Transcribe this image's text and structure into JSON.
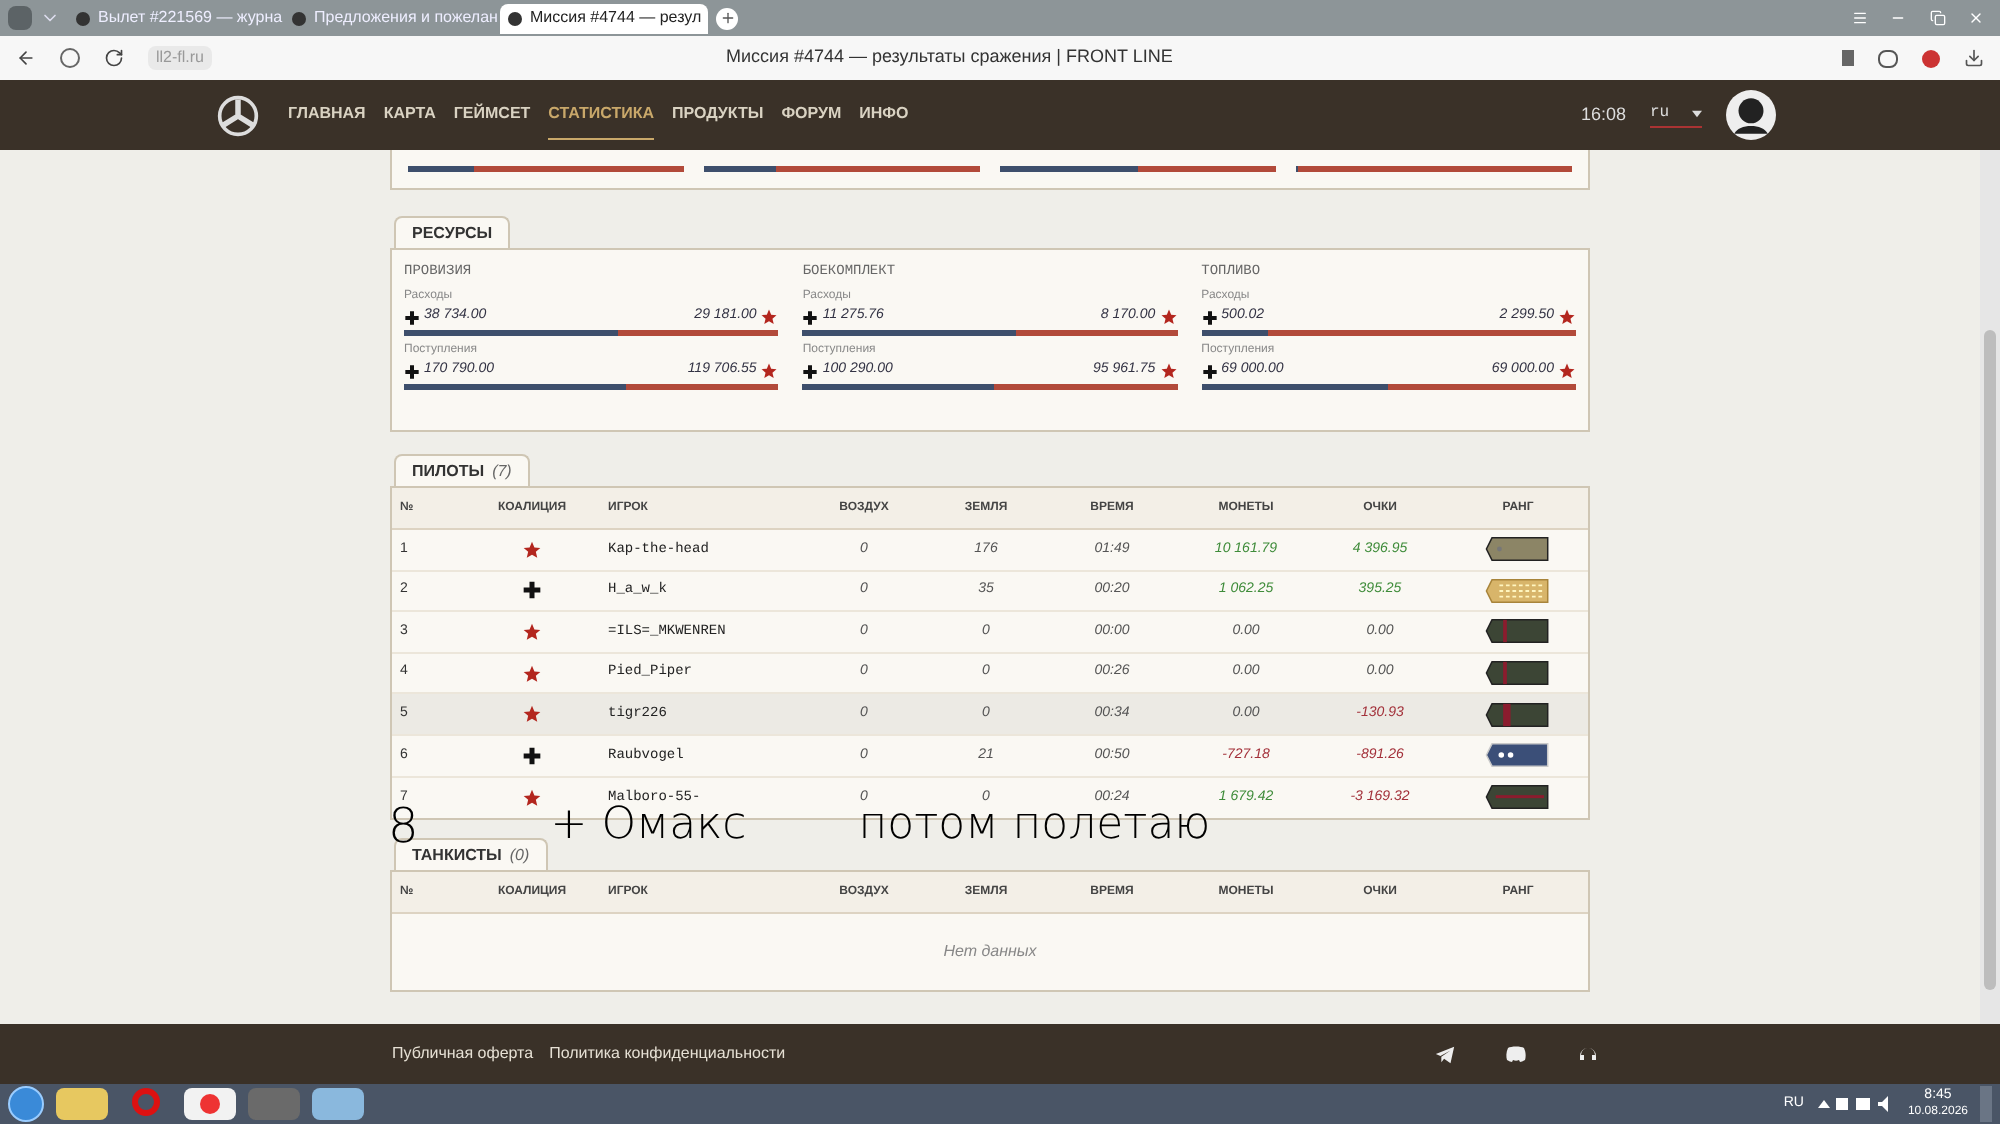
{
  "browser": {
    "tabs": [
      {
        "title": "Вылет #221569 — журна",
        "selected": false
      },
      {
        "title": "Предложения и пожелан",
        "selected": false
      },
      {
        "title": "Миссия #4744 — резул",
        "selected": true
      }
    ],
    "address": "ll2-fl.ru",
    "page_title": "Миссия #4744 — результаты сражения | FRONT LINE"
  },
  "site_nav": {
    "items": [
      {
        "label": "ГЛАВНАЯ",
        "selected": false
      },
      {
        "label": "КАРТА",
        "selected": false
      },
      {
        "label": "ГЕЙМСЕТ",
        "selected": false
      },
      {
        "label": "СТАТИСТИКА",
        "selected": true
      },
      {
        "label": "ПРОДУКТЫ",
        "selected": false
      },
      {
        "label": "ФОРУМ",
        "selected": false
      },
      {
        "label": "ИНФО",
        "selected": false
      }
    ],
    "time": "16:08",
    "language": "ru"
  },
  "top_bars": [
    {
      "level": 0.24
    },
    {
      "level": 0.26
    },
    {
      "level": 0.5
    },
    {
      "level": 0.01
    }
  ],
  "resources": {
    "title": "РЕСУРСЫ",
    "groups": [
      {
        "name": "ПРОВИЗИЯ",
        "rows": [
          {
            "label": "Расходы",
            "axis": "38 734.00",
            "allies": "29 181.00",
            "level": 0.57
          },
          {
            "label": "Поступления",
            "axis": "170 790.00",
            "allies": "119 706.55",
            "level": 0.59
          }
        ]
      },
      {
        "name": "БОЕКОМПЛЕКТ",
        "rows": [
          {
            "label": "Расходы",
            "axis": "11 275.76",
            "allies": "8 170.00",
            "level": 0.57
          },
          {
            "label": "Поступления",
            "axis": "100 290.00",
            "allies": "95 961.75",
            "level": 0.51
          }
        ]
      },
      {
        "name": "ТОПЛИВО",
        "rows": [
          {
            "label": "Расходы",
            "axis": "500.02",
            "allies": "2 299.50",
            "level": 0.18
          },
          {
            "label": "Поступления",
            "axis": "69 000.00",
            "allies": "69 000.00",
            "level": 0.5
          }
        ]
      }
    ]
  },
  "pilots": {
    "title": "ПИЛОТЫ",
    "count": "(7)",
    "columns": [
      "№",
      "КОАЛИЦИЯ",
      "ИГРОК",
      "ВОЗДУХ",
      "ЗЕМЛЯ",
      "ВРЕМЯ",
      "МОНЕТЫ",
      "ОЧКИ",
      "РАНГ"
    ],
    "rows": [
      {
        "n": "1",
        "coalition": {
          "kind": "allies"
        },
        "player": "Kap-the-head",
        "air": "0",
        "ground": "176",
        "time": "01:49",
        "coins": {
          "text": "10 161.79",
          "kind": "gain"
        },
        "points": {
          "text": "4 396.95",
          "kind": "gain"
        },
        "rank": {
          "kind": "gold"
        },
        "selected": false
      },
      {
        "n": "2",
        "coalition": {
          "kind": "axis"
        },
        "player": "H_a_w_k",
        "air": "0",
        "ground": "35",
        "time": "00:20",
        "coins": {
          "text": "1 062.25",
          "kind": "gain"
        },
        "points": {
          "text": "395.25",
          "kind": "gain"
        },
        "rank": {
          "kind": "braid"
        },
        "selected": false
      },
      {
        "n": "3",
        "coalition": {
          "kind": "allies"
        },
        "player": "=ILS=_MKWENREN",
        "air": "0",
        "ground": "0",
        "time": "00:00",
        "coins": {
          "text": "0.00",
          "kind": "zero"
        },
        "points": {
          "text": "0.00",
          "kind": "zero"
        },
        "rank": {
          "kind": "stripe"
        },
        "selected": false
      },
      {
        "n": "4",
        "coalition": {
          "kind": "allies"
        },
        "player": "Pied_Piper",
        "air": "0",
        "ground": "0",
        "time": "00:26",
        "coins": {
          "text": "0.00",
          "kind": "zero"
        },
        "points": {
          "text": "0.00",
          "kind": "zero"
        },
        "rank": {
          "kind": "stripe"
        },
        "selected": false
      },
      {
        "n": "5",
        "coalition": {
          "kind": "allies"
        },
        "player": "tigr226",
        "air": "0",
        "ground": "0",
        "time": "00:34",
        "coins": {
          "text": "0.00",
          "kind": "zero"
        },
        "points": {
          "text": "-130.93",
          "kind": "loss"
        },
        "rank": {
          "kind": "wide"
        },
        "selected": true
      },
      {
        "n": "6",
        "coalition": {
          "kind": "axis"
        },
        "player": "Raubvogel",
        "air": "0",
        "ground": "21",
        "time": "00:50",
        "coins": {
          "text": "-727.18",
          "kind": "loss"
        },
        "points": {
          "text": "-891.26",
          "kind": "loss"
        },
        "rank": {
          "kind": "pips"
        },
        "selected": false
      },
      {
        "n": "7",
        "coalition": {
          "kind": "allies"
        },
        "player": "Malboro-55-",
        "air": "0",
        "ground": "0",
        "time": "00:24",
        "coins": {
          "text": "1 679.42",
          "kind": "gain"
        },
        "points": {
          "text": "-3 169.32",
          "kind": "loss"
        },
        "rank": {
          "kind": "bar"
        },
        "selected": false
      }
    ]
  },
  "tankers": {
    "title": "ТАНКИСТЫ",
    "count": "(0)",
    "columns": [
      "№",
      "КОАЛИЦИЯ",
      "ИГРОК",
      "ВОЗДУХ",
      "ЗЕМЛЯ",
      "ВРЕМЯ",
      "МОНЕТЫ",
      "ОЧКИ",
      "РАНГ"
    ],
    "empty": "Нет данных"
  },
  "annotation": {
    "number": "8",
    "name": "+ Омакс",
    "note": "потом полетаю"
  },
  "footer": {
    "links": [
      "Публичная оферта",
      "Политика конфиденциальности"
    ]
  },
  "taskbar": {
    "language": "RU",
    "time": "8:45",
    "date": "10.08.2026"
  }
}
